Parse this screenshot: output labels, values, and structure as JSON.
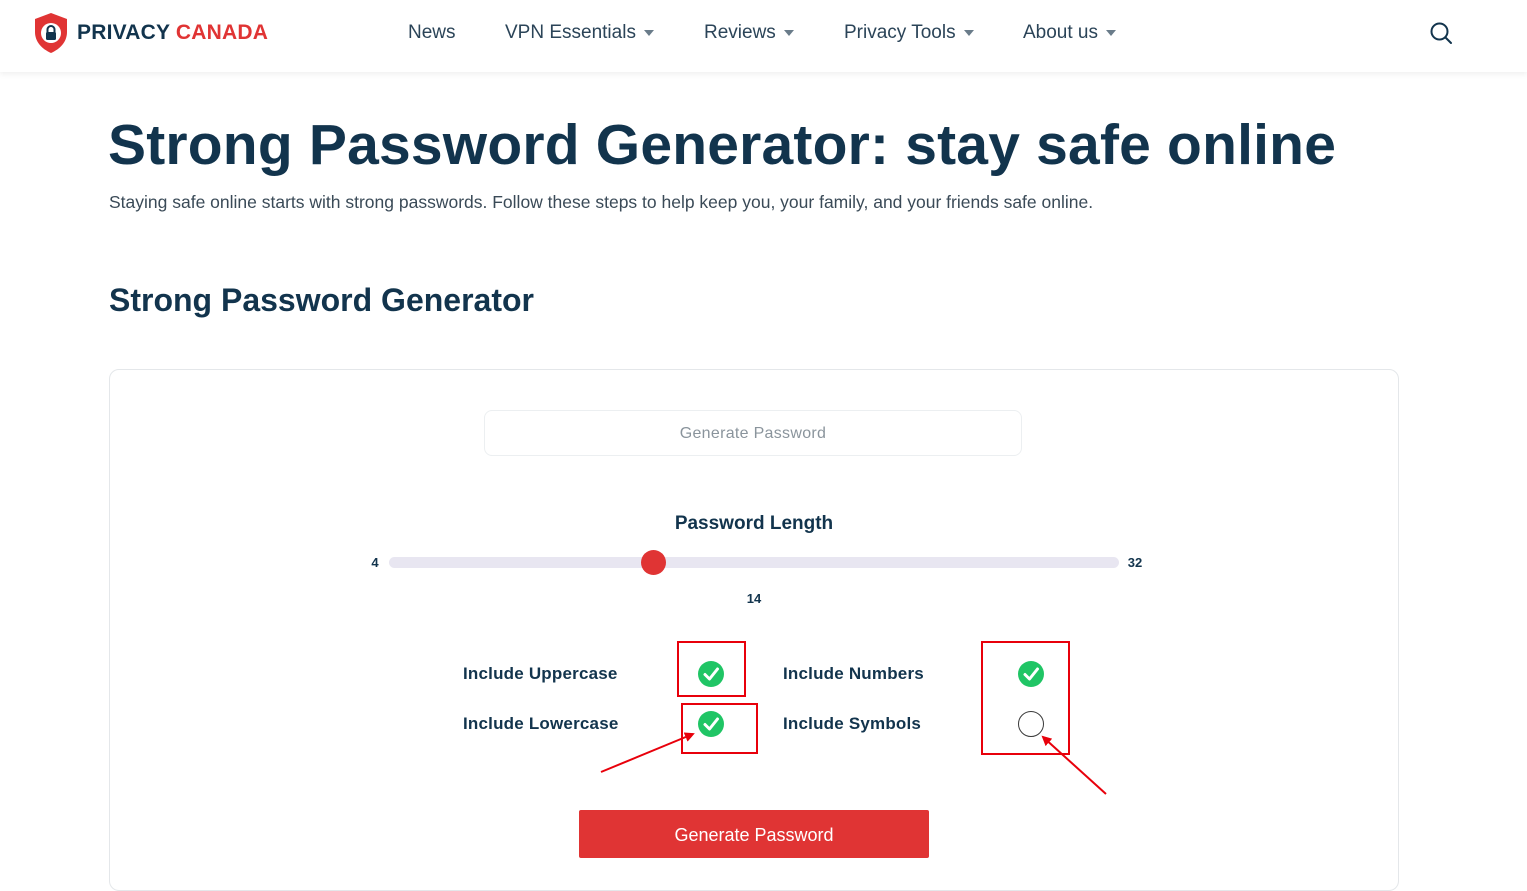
{
  "header": {
    "logo_word1": "PRIVACY",
    "logo_word2": "CANADA",
    "nav": [
      {
        "label": "News",
        "has_dropdown": false
      },
      {
        "label": "VPN Essentials",
        "has_dropdown": true
      },
      {
        "label": "Reviews",
        "has_dropdown": true
      },
      {
        "label": "Privacy Tools",
        "has_dropdown": true
      },
      {
        "label": "About us",
        "has_dropdown": true
      }
    ],
    "search_icon": "search-icon"
  },
  "page": {
    "title": "Strong Password Generator: stay safe online",
    "subtitle": "Staying safe online starts with strong passwords. Follow these steps to help keep you, your family, and your friends safe online."
  },
  "generator": {
    "heading": "Strong Password Generator",
    "password_placeholder": "Generate Password",
    "length_label": "Password Length",
    "length_min": "4",
    "length_max": "32",
    "length_value": "14",
    "options": {
      "uppercase": {
        "label": "Include Uppercase",
        "checked": true
      },
      "lowercase": {
        "label": "Include Lowercase",
        "checked": true
      },
      "numbers": {
        "label": "Include Numbers",
        "checked": true
      },
      "symbols": {
        "label": "Include Symbols",
        "checked": false
      }
    },
    "generate_button": "Generate Password"
  },
  "colors": {
    "brand_red": "#e03434",
    "brand_navy": "#12344d",
    "check_green": "#20c565",
    "annotation_red": "#e8000b"
  }
}
